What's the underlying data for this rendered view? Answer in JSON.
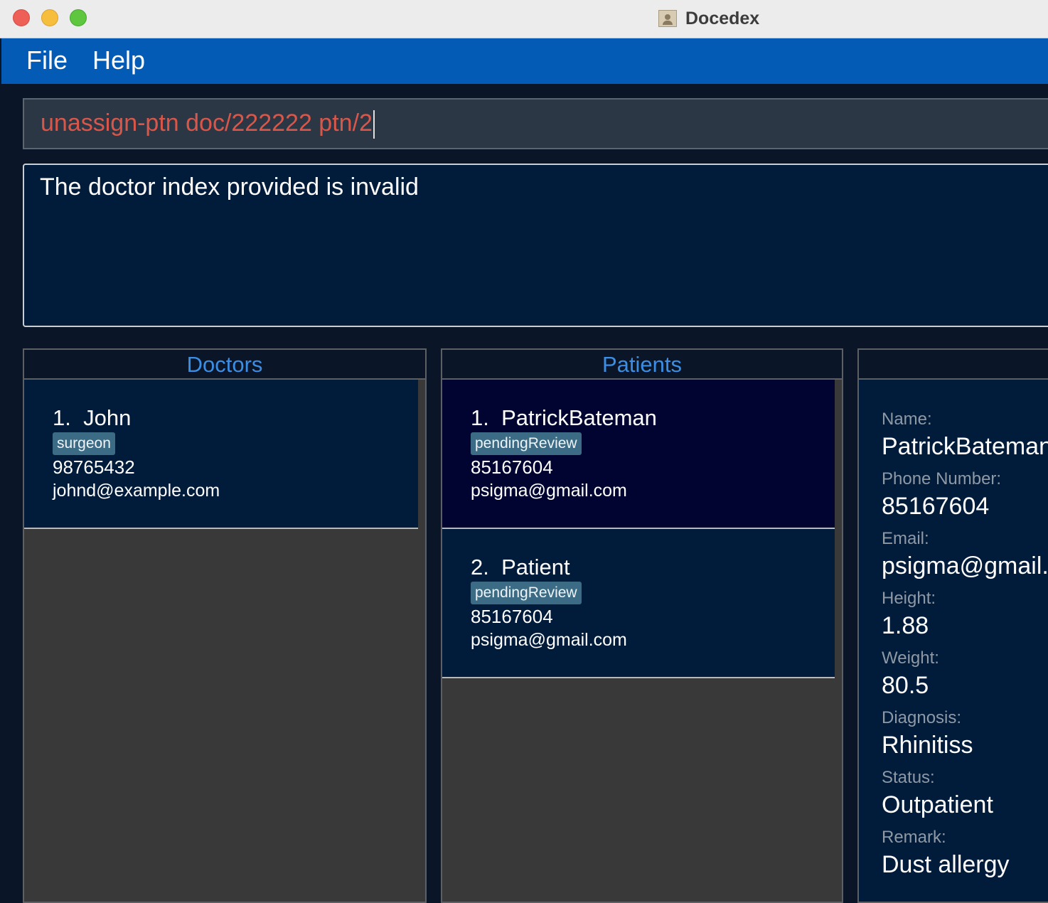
{
  "window": {
    "title": "Docedex"
  },
  "menu": {
    "items": [
      "File",
      "Help"
    ]
  },
  "command": {
    "value": "unassign-ptn doc/222222 ptn/2"
  },
  "result": {
    "message": "The doctor index provided is invalid"
  },
  "doctors": {
    "header": "Doctors",
    "items": [
      {
        "index": "1.",
        "name": "John",
        "tag": "surgeon",
        "phone": "98765432",
        "email": "johnd@example.com"
      }
    ]
  },
  "patients": {
    "header": "Patients",
    "items": [
      {
        "index": "1.",
        "name": "PatrickBateman",
        "tag": "pendingReview",
        "phone": "85167604",
        "email": "psigma@gmail.com"
      },
      {
        "index": "2.",
        "name": "Patient",
        "tag": "pendingReview",
        "phone": "85167604",
        "email": "psigma@gmail.com"
      }
    ]
  },
  "details": {
    "fields": [
      {
        "label": "Name:",
        "value": "PatrickBateman"
      },
      {
        "label": "Phone Number:",
        "value": "85167604"
      },
      {
        "label": "Email:",
        "value": "psigma@gmail.com"
      },
      {
        "label": "Height:",
        "value": "1.88"
      },
      {
        "label": "Weight:",
        "value": "80.5"
      },
      {
        "label": "Diagnosis:",
        "value": "Rhinitiss"
      },
      {
        "label": "Status:",
        "value": "Outpatient"
      },
      {
        "label": "Remark:",
        "value": "Dust allergy"
      }
    ]
  },
  "colors": {
    "menubar": "#045bb5",
    "command_text": "#d9574a",
    "panel_header_text": "#3b8ee4",
    "tag_bg": "#3c6c85",
    "selected_card": "#010430"
  }
}
